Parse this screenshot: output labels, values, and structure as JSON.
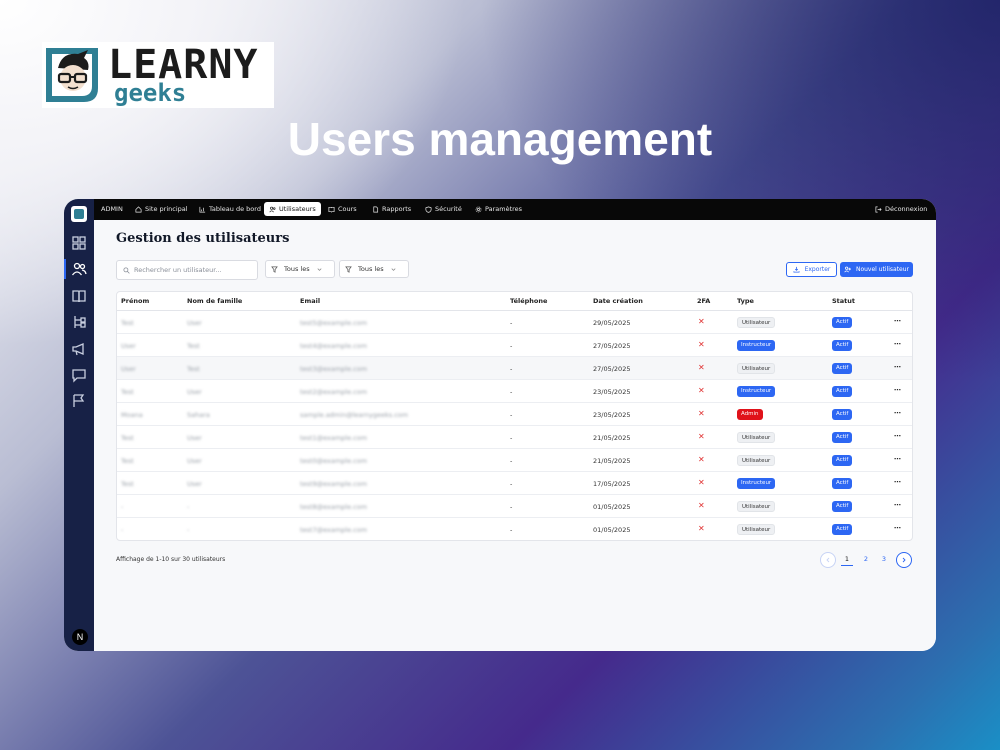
{
  "brand": {
    "line1": "LEARNY",
    "line2": "geeks",
    "teal": "#2f7f94"
  },
  "headline": "Users management",
  "topbar": {
    "role": "ADMIN",
    "items": [
      {
        "label": "Site principal",
        "icon": "home-icon"
      },
      {
        "label": "Tableau de bord",
        "icon": "chart-icon"
      },
      {
        "label": "Utilisateurs",
        "icon": "users-icon",
        "active": true
      },
      {
        "label": "Cours",
        "icon": "book-icon"
      },
      {
        "label": "Rapports",
        "icon": "file-icon"
      },
      {
        "label": "Sécurité",
        "icon": "shield-icon"
      },
      {
        "label": "Paramètres",
        "icon": "gear-icon"
      }
    ],
    "logout": "Déconnexion"
  },
  "sidebar": {
    "icons": [
      "dashboard-icon",
      "users-icon",
      "book-icon",
      "tree-icon",
      "megaphone-icon",
      "chat-icon",
      "flag-icon"
    ],
    "badge": "N"
  },
  "main": {
    "title": "Gestion des utilisateurs",
    "search_placeholder": "Rechercher un utilisateur...",
    "filter_type": "Tous les types",
    "filter_status": "Tous les statuts",
    "export_label": "Exporter",
    "new_user_label": "Nouvel utilisateur"
  },
  "table": {
    "headers": {
      "first_name": "Prénom",
      "last_name": "Nom de famille",
      "email": "Email",
      "phone": "Téléphone",
      "created": "Date création",
      "twofa": "2FA",
      "type": "Type",
      "status": "Statut"
    },
    "rows": [
      {
        "first": "Test",
        "last": "User",
        "email": "test5@example.com",
        "phone": "-",
        "created": "29/05/2025",
        "twofa": "✕",
        "type": "Utilisateur",
        "status": "Actif",
        "menu": "⋯"
      },
      {
        "first": "User",
        "last": "Test",
        "email": "test4@example.com",
        "phone": "-",
        "created": "27/05/2025",
        "twofa": "✕",
        "type": "Instructeur",
        "status": "Actif",
        "menu": "⋯"
      },
      {
        "first": "User",
        "last": "Test",
        "email": "test3@example.com",
        "phone": "-",
        "created": "27/05/2025",
        "twofa": "✕",
        "type": "Utilisateur",
        "status": "Actif",
        "menu": "⋯"
      },
      {
        "first": "Test",
        "last": "User",
        "email": "test2@example.com",
        "phone": "-",
        "created": "23/05/2025",
        "twofa": "✕",
        "type": "Instructeur",
        "status": "Actif",
        "menu": "⋯"
      },
      {
        "first": "Moana",
        "last": "Sahara",
        "email": "sample.admin@learnygeeks.com",
        "phone": "-",
        "created": "23/05/2025",
        "twofa": "✕",
        "type": "Admin",
        "status": "Actif",
        "menu": "⋯"
      },
      {
        "first": "Test",
        "last": "User",
        "email": "test1@example.com",
        "phone": "-",
        "created": "21/05/2025",
        "twofa": "✕",
        "type": "Utilisateur",
        "status": "Actif",
        "menu": "⋯"
      },
      {
        "first": "Test",
        "last": "User",
        "email": "test0@example.com",
        "phone": "-",
        "created": "21/05/2025",
        "twofa": "✕",
        "type": "Utilisateur",
        "status": "Actif",
        "menu": "⋯"
      },
      {
        "first": "Test",
        "last": "User",
        "email": "test9@example.com",
        "phone": "-",
        "created": "17/05/2025",
        "twofa": "✕",
        "type": "Instructeur",
        "status": "Actif",
        "menu": "⋯"
      },
      {
        "first": "-",
        "last": "-",
        "email": "test8@example.com",
        "phone": "-",
        "created": "01/05/2025",
        "twofa": "✕",
        "type": "Utilisateur",
        "status": "Actif",
        "menu": "⋯"
      },
      {
        "first": "-",
        "last": "-",
        "email": "test7@example.com",
        "phone": "-",
        "created": "01/05/2025",
        "twofa": "✕",
        "type": "Utilisateur",
        "status": "Actif",
        "menu": "⋯"
      }
    ]
  },
  "footer": {
    "info": "Affichage de 1-10 sur 30 utilisateurs",
    "pages": [
      "1",
      "2",
      "3"
    ],
    "current_page": "1"
  },
  "colors": {
    "accent": "#2d67f3",
    "danger": "#e0121a",
    "sidebar": "#172146"
  }
}
